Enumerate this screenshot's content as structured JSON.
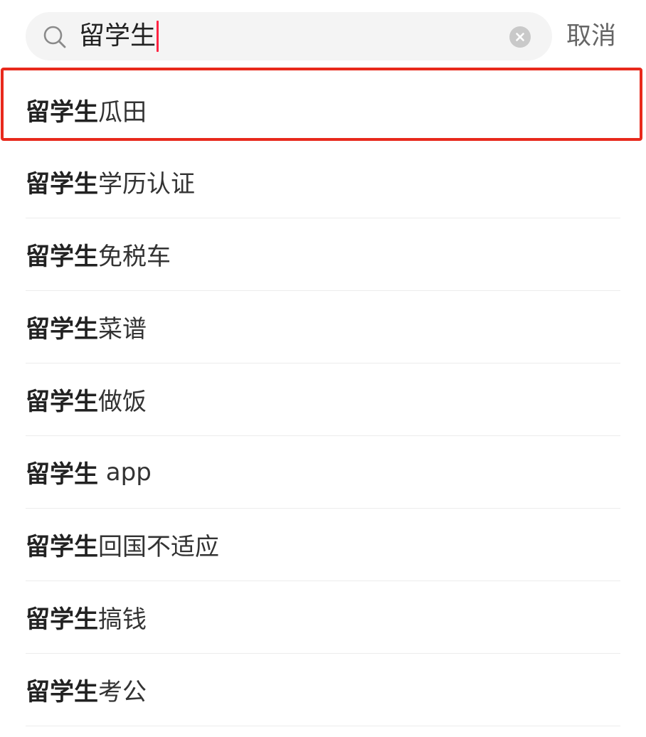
{
  "search": {
    "query": "留学生",
    "cancel_label": "取消"
  },
  "suggestions": [
    {
      "prefix": "留学生",
      "rest": "瓜田"
    },
    {
      "prefix": "留学生",
      "rest": "学历认证"
    },
    {
      "prefix": "留学生",
      "rest": "免税车"
    },
    {
      "prefix": "留学生",
      "rest": "菜谱"
    },
    {
      "prefix": "留学生",
      "rest": "做饭"
    },
    {
      "prefix": "留学生",
      "rest": " app"
    },
    {
      "prefix": "留学生",
      "rest": "回国不适应"
    },
    {
      "prefix": "留学生",
      "rest": "搞钱"
    },
    {
      "prefix": "留学生",
      "rest": "考公"
    }
  ],
  "colors": {
    "caret": "#ff2442",
    "highlight_border": "#e8291c",
    "search_bg": "#f4f4f4"
  }
}
